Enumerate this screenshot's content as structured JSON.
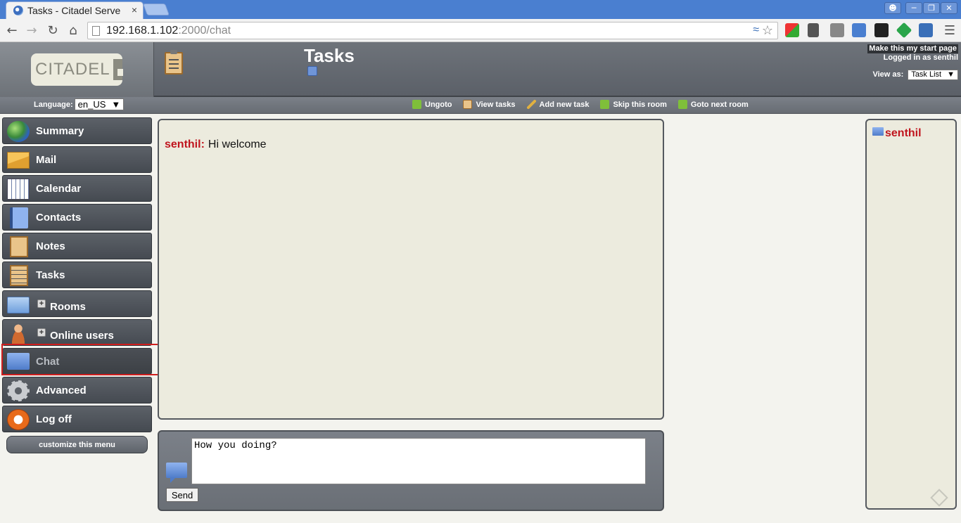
{
  "browser": {
    "tab_title": "Tasks - Citadel Serve",
    "tab_close": "×",
    "url_host": "192.168.1.102",
    "url_path": ":2000/chat"
  },
  "header": {
    "logo_text": "CITADEL",
    "page_title": "Tasks",
    "start_page_link": "Make this my start page",
    "logged_in": "Logged in as senthil",
    "view_as_label": "View as:",
    "view_as_value": "Task List"
  },
  "roombar": {
    "language_label": "Language:",
    "language_value": "en_US",
    "links": [
      {
        "label": "Ungoto",
        "icon": "ungoto-icon",
        "color": "#7fbf3a"
      },
      {
        "label": "View tasks",
        "icon": "clipboard-icon",
        "color": "#e9c48a"
      },
      {
        "label": "Add new task",
        "icon": "pencil-icon",
        "color": "#e0b040"
      },
      {
        "label": "Skip this room",
        "icon": "skip-arrow-icon",
        "color": "#7fbf3a"
      },
      {
        "label": "Goto next room",
        "icon": "goto-arrow-icon",
        "color": "#7fbf3a"
      }
    ]
  },
  "menu": {
    "items": [
      {
        "label": "Summary"
      },
      {
        "label": "Mail"
      },
      {
        "label": "Calendar"
      },
      {
        "label": "Contacts"
      },
      {
        "label": "Notes"
      },
      {
        "label": "Tasks"
      },
      {
        "label": "Rooms"
      },
      {
        "label": "Online users"
      },
      {
        "label": "Chat"
      },
      {
        "label": "Advanced"
      },
      {
        "label": "Log off"
      }
    ],
    "customize_label": "customize this menu"
  },
  "chat": {
    "messages": [
      {
        "sender": "senthil:",
        "text": "Hi welcome"
      }
    ],
    "input_value": "How you doing?",
    "send_label": "Send",
    "online_user": "senthil"
  },
  "colors": {
    "accent_red": "#c0151e",
    "header_gray": "#5b6068",
    "panel_beige": "#ecebde"
  }
}
